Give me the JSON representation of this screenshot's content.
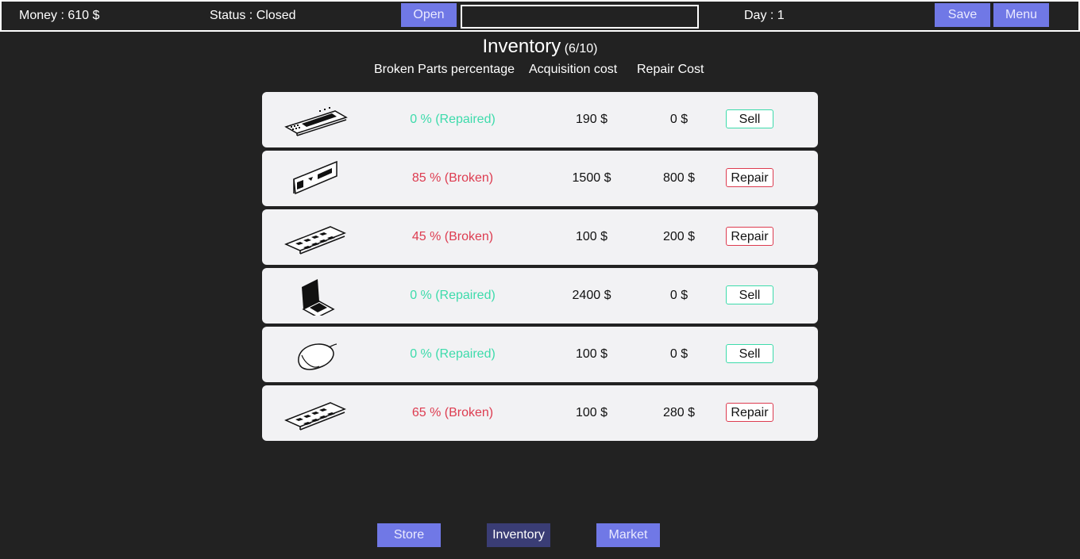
{
  "topbar": {
    "money_label": "Money :  610 $",
    "status_label": "Status :  Closed",
    "open_button": "Open",
    "name_input_value": "",
    "day_label": "Day : 1",
    "save_button": "Save",
    "menu_button": "Menu"
  },
  "inventory": {
    "title": "Inventory",
    "count": "(6/10)",
    "columns": [
      "Broken Parts percentage",
      "Acquisition cost",
      "Repair Cost"
    ],
    "items": [
      {
        "icon": "keyboard-icon",
        "percentage": "0 % (Repaired)",
        "acquisition": "190 $",
        "repair": "0 $",
        "action": "Sell",
        "state": "repaired"
      },
      {
        "icon": "graphics-card-icon",
        "percentage": "85 % (Broken)",
        "acquisition": "1500 $",
        "repair": "800 $",
        "action": "Repair",
        "state": "broken"
      },
      {
        "icon": "ram-module-icon",
        "percentage": "45 % (Broken)",
        "acquisition": "100 $",
        "repair": "200 $",
        "action": "Repair",
        "state": "broken"
      },
      {
        "icon": "laptop-icon",
        "percentage": "0 % (Repaired)",
        "acquisition": "2400 $",
        "repair": "0 $",
        "action": "Sell",
        "state": "repaired"
      },
      {
        "icon": "mouse-icon",
        "percentage": "0 % (Repaired)",
        "acquisition": "100 $",
        "repair": "0 $",
        "action": "Sell",
        "state": "repaired"
      },
      {
        "icon": "ram-module-icon",
        "percentage": "65 % (Broken)",
        "acquisition": "100 $",
        "repair": "280 $",
        "action": "Repair",
        "state": "broken"
      }
    ]
  },
  "nav": {
    "store": "Store",
    "inventory": "Inventory",
    "market": "Market",
    "active": "inventory"
  },
  "colors": {
    "accent": "#7078e6",
    "repaired": "#3ddbab",
    "broken": "#dd3c50",
    "background": "#222222"
  }
}
